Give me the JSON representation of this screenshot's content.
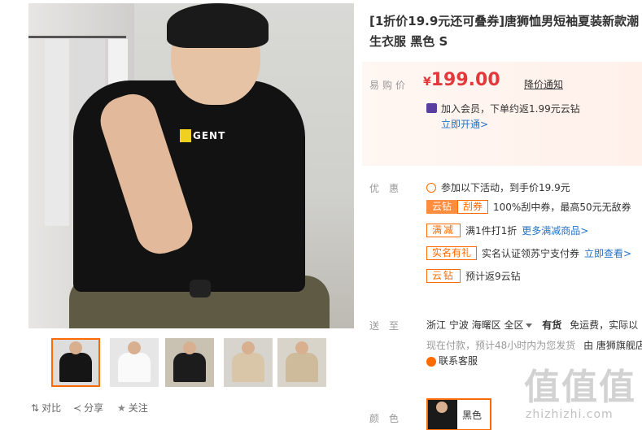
{
  "product": {
    "title": "[1折价19.9元还可叠券]唐狮恤男短袖夏装新款潮生衣服 黑色 S",
    "shirt_logo": "GENT",
    "shirt_logo_letter": "A"
  },
  "price": {
    "label": "易购价",
    "currency": "¥",
    "value": "199.00",
    "notice_link": "降价通知",
    "vip_text": "加入会员，下单约返1.99元云钻",
    "vip_link": "立即开通>"
  },
  "promo": {
    "label": "优惠",
    "activity": "参加以下活动，到手价19.9元",
    "rows": [
      {
        "tag1": "云钻",
        "tag2": "刮券",
        "text": "100%刮中券，最高50元无敌券"
      },
      {
        "tag": "满减",
        "text": "满1件打1折",
        "link": "更多满减商品>"
      },
      {
        "tag": "实名有礼",
        "text": "实名认证领苏宁支付券",
        "link": "立即查看>"
      },
      {
        "tag": "云钻",
        "text": "预计返9云钻"
      }
    ]
  },
  "shipping": {
    "label": "送至",
    "location": "浙江 宁波 海曙区 全区",
    "stock": "有货",
    "freight": "免运费，实际以",
    "delivery": "现在付款，预计48小时内为您发货",
    "from": "由 唐狮旗舰店",
    "service": "联系客服"
  },
  "color": {
    "label": "颜色",
    "option": "黑色"
  },
  "actions": {
    "compare": "对比",
    "share": "分享",
    "follow": "关注"
  },
  "watermark": {
    "big": "值值值",
    "small": "zhizhizhi.com"
  },
  "colors": {
    "accent": "#ff6a00",
    "price": "#e4393c",
    "link": "#2272c8"
  }
}
